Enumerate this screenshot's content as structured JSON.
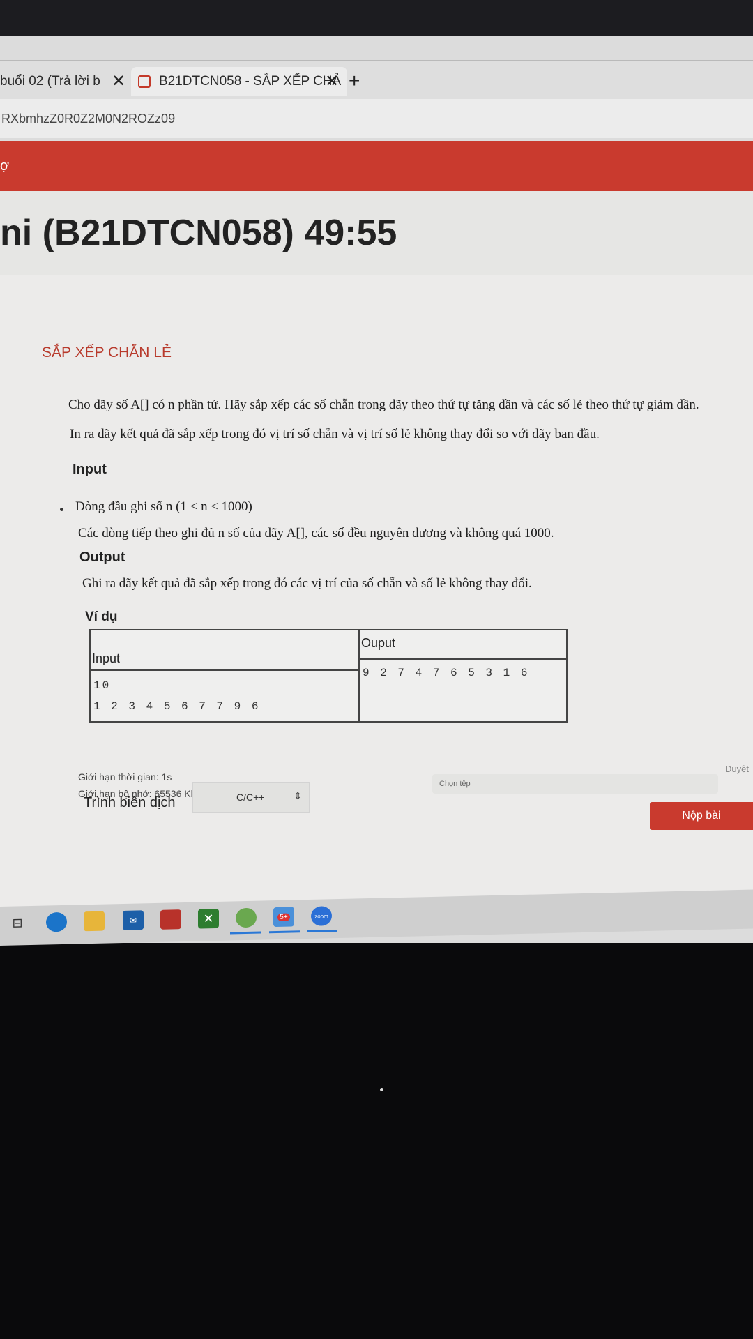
{
  "browser": {
    "tabs": [
      {
        "label": "buổi 02 (Trả lời b",
        "close": "✕"
      },
      {
        "label": "B21DTCN058 - SẮP XẾP CHẢ",
        "close": "✕"
      }
    ],
    "new_tab": "+",
    "url": "RXbmhzZ0R0Z2M0N2ROZz09"
  },
  "site": {
    "nav_fragment": "ợ",
    "exam_title": "ni (B21DTCN058) 49:55"
  },
  "problem": {
    "title": "SẮP XẾP CHẴN LẺ",
    "description_1": "Cho dãy số A[] có n phần tử. Hãy sắp xếp các số chẵn trong dãy theo thứ tự tăng dần và các số lẻ theo thứ tự giảm dần.",
    "description_2": "In ra dãy kết quả đã sắp xếp trong đó vị trí số chẵn và vị trí số lẻ không thay đổi so với dãy ban đầu.",
    "input_heading": "Input",
    "input_line_1": "Dòng đầu ghi số n (1 < n ≤ 1000)",
    "input_line_2": "Các dòng tiếp theo ghi đủ n số của dãy A[], các số đều nguyên dương và không quá 1000.",
    "output_heading": "Output",
    "output_line": "Ghi ra dãy kết quả đã sắp xếp trong đó các vị trí của số chẵn và số lẻ không thay đổi.",
    "example_label": "Ví dụ",
    "example": {
      "input_header": "Input",
      "output_header": "Ouput",
      "input_lines": [
        "10",
        "1 2 3 4 5 6 7 7 9 6"
      ],
      "output_lines": [
        "9 2 7 4 7 6 5 3 1 6"
      ]
    },
    "time_limit": "Giới hạn thời gian: 1s",
    "memory_limit": "Giới hạn bộ nhớ: 65536 Kb"
  },
  "submission": {
    "file_placeholder": "Chọn tệp",
    "browse_label": "Duyệt",
    "compiler_label": "Trình biên dịch",
    "compiler_value": "C/C++",
    "submit_label": "Nộp bài"
  },
  "taskbar": {
    "icons": [
      "taskview-icon",
      "edge-icon",
      "file-explorer-icon",
      "mail-icon",
      "app-icon",
      "xbox-icon",
      "coccoc-icon",
      "zalo-icon",
      "zoom-icon"
    ],
    "zalo_badge": "5+",
    "zoom_label": "zoom"
  }
}
